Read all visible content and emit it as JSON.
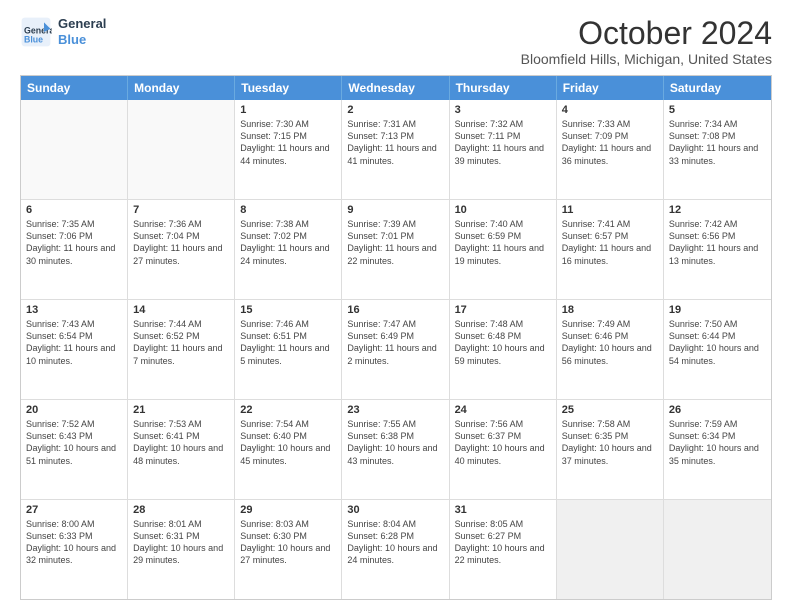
{
  "logo": {
    "line1": "General",
    "line2": "Blue"
  },
  "title": "October 2024",
  "location": "Bloomfield Hills, Michigan, United States",
  "days": [
    "Sunday",
    "Monday",
    "Tuesday",
    "Wednesday",
    "Thursday",
    "Friday",
    "Saturday"
  ],
  "weeks": [
    [
      {
        "day": "",
        "info": ""
      },
      {
        "day": "",
        "info": ""
      },
      {
        "day": "1",
        "info": "Sunrise: 7:30 AM\nSunset: 7:15 PM\nDaylight: 11 hours and 44 minutes."
      },
      {
        "day": "2",
        "info": "Sunrise: 7:31 AM\nSunset: 7:13 PM\nDaylight: 11 hours and 41 minutes."
      },
      {
        "day": "3",
        "info": "Sunrise: 7:32 AM\nSunset: 7:11 PM\nDaylight: 11 hours and 39 minutes."
      },
      {
        "day": "4",
        "info": "Sunrise: 7:33 AM\nSunset: 7:09 PM\nDaylight: 11 hours and 36 minutes."
      },
      {
        "day": "5",
        "info": "Sunrise: 7:34 AM\nSunset: 7:08 PM\nDaylight: 11 hours and 33 minutes."
      }
    ],
    [
      {
        "day": "6",
        "info": "Sunrise: 7:35 AM\nSunset: 7:06 PM\nDaylight: 11 hours and 30 minutes."
      },
      {
        "day": "7",
        "info": "Sunrise: 7:36 AM\nSunset: 7:04 PM\nDaylight: 11 hours and 27 minutes."
      },
      {
        "day": "8",
        "info": "Sunrise: 7:38 AM\nSunset: 7:02 PM\nDaylight: 11 hours and 24 minutes."
      },
      {
        "day": "9",
        "info": "Sunrise: 7:39 AM\nSunset: 7:01 PM\nDaylight: 11 hours and 22 minutes."
      },
      {
        "day": "10",
        "info": "Sunrise: 7:40 AM\nSunset: 6:59 PM\nDaylight: 11 hours and 19 minutes."
      },
      {
        "day": "11",
        "info": "Sunrise: 7:41 AM\nSunset: 6:57 PM\nDaylight: 11 hours and 16 minutes."
      },
      {
        "day": "12",
        "info": "Sunrise: 7:42 AM\nSunset: 6:56 PM\nDaylight: 11 hours and 13 minutes."
      }
    ],
    [
      {
        "day": "13",
        "info": "Sunrise: 7:43 AM\nSunset: 6:54 PM\nDaylight: 11 hours and 10 minutes."
      },
      {
        "day": "14",
        "info": "Sunrise: 7:44 AM\nSunset: 6:52 PM\nDaylight: 11 hours and 7 minutes."
      },
      {
        "day": "15",
        "info": "Sunrise: 7:46 AM\nSunset: 6:51 PM\nDaylight: 11 hours and 5 minutes."
      },
      {
        "day": "16",
        "info": "Sunrise: 7:47 AM\nSunset: 6:49 PM\nDaylight: 11 hours and 2 minutes."
      },
      {
        "day": "17",
        "info": "Sunrise: 7:48 AM\nSunset: 6:48 PM\nDaylight: 10 hours and 59 minutes."
      },
      {
        "day": "18",
        "info": "Sunrise: 7:49 AM\nSunset: 6:46 PM\nDaylight: 10 hours and 56 minutes."
      },
      {
        "day": "19",
        "info": "Sunrise: 7:50 AM\nSunset: 6:44 PM\nDaylight: 10 hours and 54 minutes."
      }
    ],
    [
      {
        "day": "20",
        "info": "Sunrise: 7:52 AM\nSunset: 6:43 PM\nDaylight: 10 hours and 51 minutes."
      },
      {
        "day": "21",
        "info": "Sunrise: 7:53 AM\nSunset: 6:41 PM\nDaylight: 10 hours and 48 minutes."
      },
      {
        "day": "22",
        "info": "Sunrise: 7:54 AM\nSunset: 6:40 PM\nDaylight: 10 hours and 45 minutes."
      },
      {
        "day": "23",
        "info": "Sunrise: 7:55 AM\nSunset: 6:38 PM\nDaylight: 10 hours and 43 minutes."
      },
      {
        "day": "24",
        "info": "Sunrise: 7:56 AM\nSunset: 6:37 PM\nDaylight: 10 hours and 40 minutes."
      },
      {
        "day": "25",
        "info": "Sunrise: 7:58 AM\nSunset: 6:35 PM\nDaylight: 10 hours and 37 minutes."
      },
      {
        "day": "26",
        "info": "Sunrise: 7:59 AM\nSunset: 6:34 PM\nDaylight: 10 hours and 35 minutes."
      }
    ],
    [
      {
        "day": "27",
        "info": "Sunrise: 8:00 AM\nSunset: 6:33 PM\nDaylight: 10 hours and 32 minutes."
      },
      {
        "day": "28",
        "info": "Sunrise: 8:01 AM\nSunset: 6:31 PM\nDaylight: 10 hours and 29 minutes."
      },
      {
        "day": "29",
        "info": "Sunrise: 8:03 AM\nSunset: 6:30 PM\nDaylight: 10 hours and 27 minutes."
      },
      {
        "day": "30",
        "info": "Sunrise: 8:04 AM\nSunset: 6:28 PM\nDaylight: 10 hours and 24 minutes."
      },
      {
        "day": "31",
        "info": "Sunrise: 8:05 AM\nSunset: 6:27 PM\nDaylight: 10 hours and 22 minutes."
      },
      {
        "day": "",
        "info": ""
      },
      {
        "day": "",
        "info": ""
      }
    ]
  ]
}
